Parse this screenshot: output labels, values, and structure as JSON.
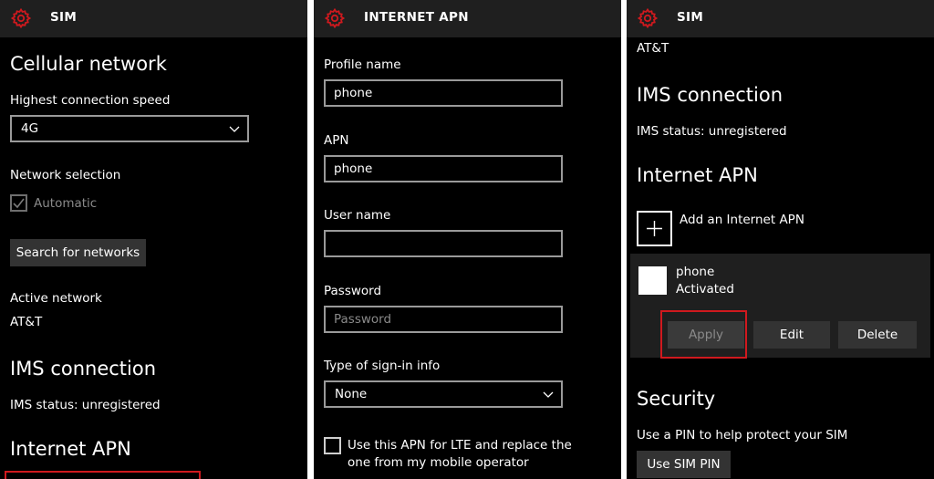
{
  "screen1": {
    "title": "SIM",
    "heading_cellular": "Cellular network",
    "highest_speed_label": "Highest connection speed",
    "highest_speed_value": "4G",
    "network_selection_label": "Network selection",
    "automatic_label": "Automatic",
    "search_networks_button": "Search for networks",
    "active_network_label": "Active network",
    "active_network_value": "AT&T",
    "heading_ims": "IMS connection",
    "ims_status": "IMS status: unregistered",
    "heading_internet_apn": "Internet APN"
  },
  "screen2": {
    "title": "INTERNET APN",
    "profile_name_label": "Profile name",
    "profile_name_value": "phone",
    "apn_label": "APN",
    "apn_value": "phone",
    "username_label": "User name",
    "username_value": "",
    "password_label": "Password",
    "password_placeholder": "Password",
    "signin_type_label": "Type of sign-in info",
    "signin_type_value": "None",
    "lte_checkbox_line1": "Use this APN for LTE and replace the",
    "lte_checkbox_line2": "one from my mobile operator"
  },
  "screen3": {
    "title": "SIM",
    "carrier": "AT&T",
    "heading_ims": "IMS connection",
    "ims_status": "IMS status: unregistered",
    "heading_internet_apn": "Internet APN",
    "add_apn_label": "Add an Internet APN",
    "apn_name": "phone",
    "apn_status": "Activated",
    "apply_button": "Apply",
    "edit_button": "Edit",
    "delete_button": "Delete",
    "heading_security": "Security",
    "security_text": "Use a PIN to help protect your SIM",
    "use_pin_button": "Use SIM PIN"
  },
  "colors": {
    "accent_red": "#d0191e",
    "background": "#000000",
    "topbar": "#1f1f1f",
    "button": "#333333"
  },
  "icons": {
    "settings": "gear-icon",
    "dropdown": "chevron-down-icon",
    "add": "plus-icon",
    "check": "check-icon"
  }
}
